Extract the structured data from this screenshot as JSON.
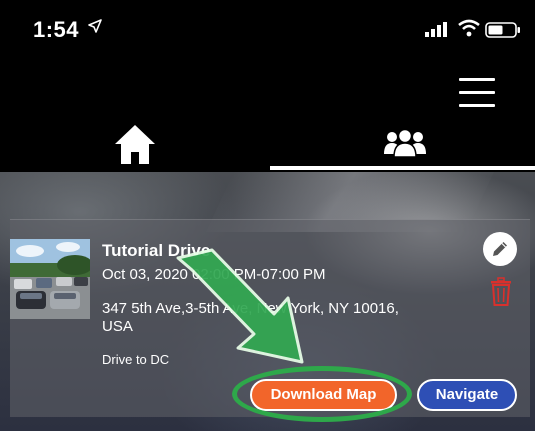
{
  "status_bar": {
    "time": "1:54",
    "icons": [
      "location-arrow-icon",
      "signal-icon",
      "wifi-icon",
      "battery-icon"
    ]
  },
  "header": {
    "menu_icon": "hamburger-menu-icon",
    "tabs": [
      {
        "icon": "home-icon",
        "selected": false
      },
      {
        "icon": "group-icon",
        "selected": true
      }
    ]
  },
  "drive": {
    "title": "Tutorial Drive",
    "time_range": "Oct 03, 2020 02:00 PM-07:00 PM",
    "address": "347 5th Ave,3-5th Ave, New York, NY 10016, USA",
    "note": "Drive to DC",
    "download_label": "Download Map",
    "navigate_label": "Navigate"
  },
  "colors": {
    "download": "#f2652a",
    "navigate": "#2e4fb5",
    "delete": "#d9302c",
    "highlight": "#2ea84a"
  }
}
